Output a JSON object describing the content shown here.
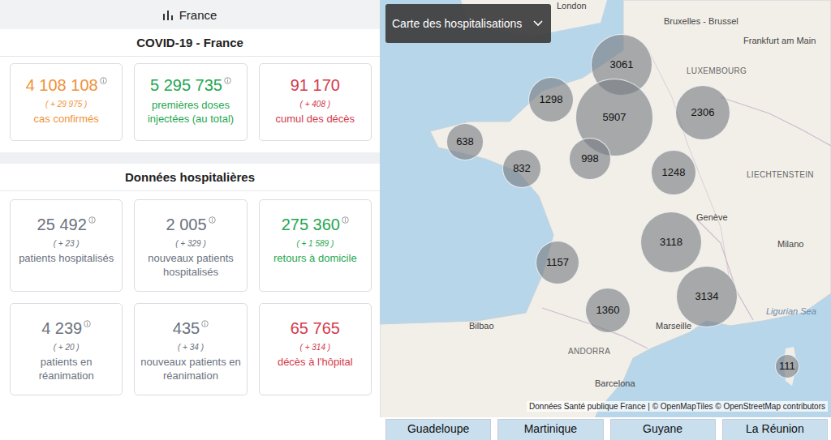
{
  "header": {
    "title": "France"
  },
  "summary": {
    "title": "COVID-19 - France",
    "cards": [
      {
        "value": "4 108 108",
        "delta": "( + 29 975 )",
        "label": "cas confirmés",
        "info": true,
        "color": "#f0923a"
      },
      {
        "value": "5 295 735",
        "delta": "",
        "label": "premières doses injectées (au total)",
        "info": true,
        "color": "#1fa750"
      },
      {
        "value": "91 170",
        "delta": "( + 408 )",
        "label": "cumul des décès",
        "info": false,
        "color": "#d43a4c"
      }
    ]
  },
  "hospital": {
    "title": "Données hospitalières",
    "cards": [
      {
        "value": "25 492",
        "delta": "( + 23 )",
        "label": "patients hospitalisés",
        "info": true,
        "color": "#6b7280"
      },
      {
        "value": "2 005",
        "delta": "( + 329 )",
        "label": "nouveaux patients hospitalisés",
        "info": true,
        "color": "#6b7280"
      },
      {
        "value": "275 360",
        "delta": "( + 1 589 )",
        "label": "retours à domicile",
        "info": true,
        "color": "#1fa750"
      },
      {
        "value": "4 239",
        "delta": "( + 20 )",
        "label": "patients en réanimation",
        "info": true,
        "color": "#6b7280"
      },
      {
        "value": "435",
        "delta": "( + 34 )",
        "label": "nouveaux patients en réanimation",
        "info": true,
        "color": "#6b7280"
      },
      {
        "value": "65 765",
        "delta": "( + 314 )",
        "label": "décès à l'hôpital",
        "info": false,
        "color": "#d43a4c"
      }
    ]
  },
  "map": {
    "dropdown": "Carte des hospitalisations",
    "markers": [
      "3061",
      "1298",
      "5907",
      "2306",
      "638",
      "832",
      "998",
      "1248",
      "3118",
      "1157",
      "1360",
      "3134",
      "111"
    ],
    "labels": [
      "London",
      "Bruxelles - Brussel",
      "Frankfurt am Main",
      "LUXEMBOURG",
      "LIECHTENSTEIN",
      "Genève",
      "Milano",
      "Bilbao",
      "ANDORRA",
      "Barcelona",
      "Marseille",
      "Ligurian Sea"
    ],
    "attribution": "Données Santé publique France | © OpenMapTiles © OpenStreetMap contributors",
    "regions": [
      "Guadeloupe",
      "Martinique",
      "Guyane",
      "La Réunion"
    ]
  }
}
